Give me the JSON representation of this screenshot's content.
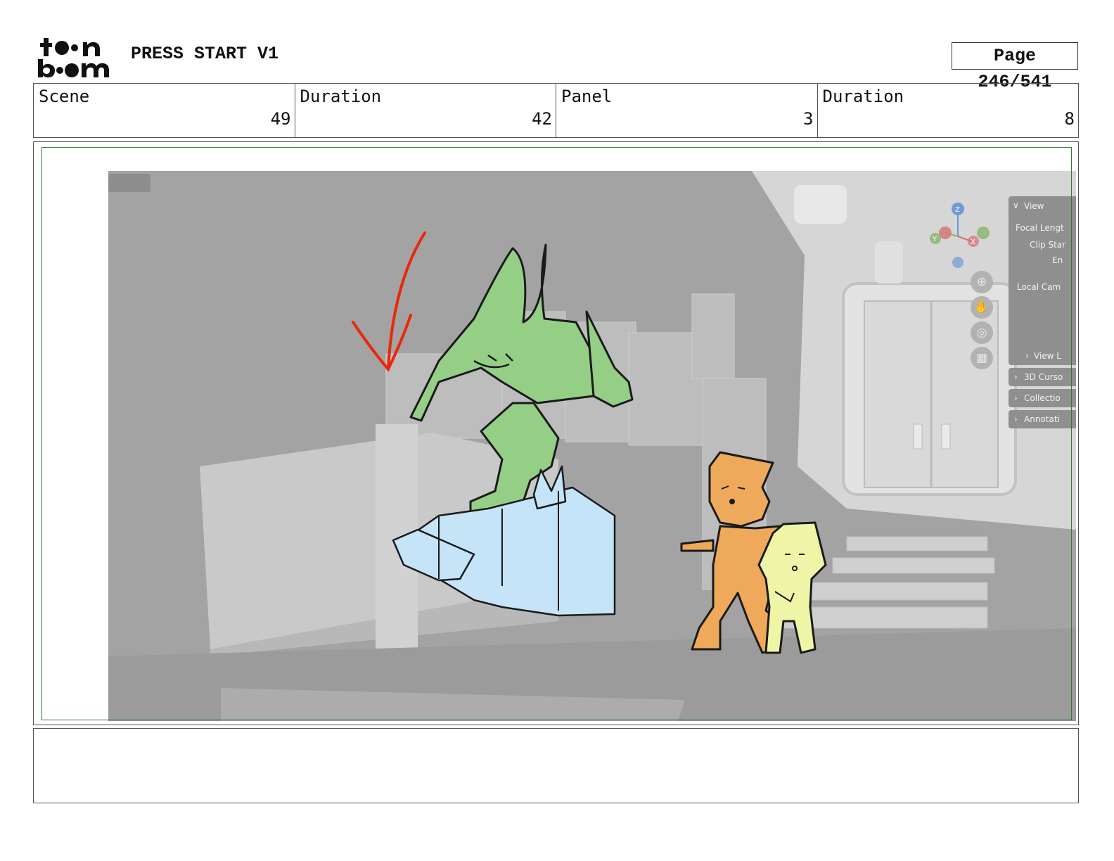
{
  "header": {
    "logo_text": "toon boom",
    "project_title": "PRESS START V1",
    "page_indicator": "Page 246/541"
  },
  "info": {
    "scene_label": "Scene",
    "scene_value": "49",
    "scene_duration_label": "Duration",
    "scene_duration_value": "42",
    "panel_label": "Panel",
    "panel_value": "3",
    "panel_duration_label": "Duration",
    "panel_duration_value": "8"
  },
  "viewport": {
    "sidebar": {
      "view_header": "View",
      "focal_length": "Focal Lengt",
      "clip_start": "Clip Star",
      "clip_end": "En",
      "local_camera": "Local Cam",
      "view_lock": "View L",
      "sections": [
        "3D Curso",
        "Collectio",
        "Annotati"
      ]
    },
    "gizmo": {
      "z": "Z",
      "y": "Y",
      "x": "X"
    },
    "nav_icons": [
      "zoom-icon",
      "hand-pan-icon",
      "camera-icon",
      "grid-icon"
    ]
  },
  "colors": {
    "safe_frame": "#2e7d32",
    "arrow": "#e8280a",
    "creature_fill": "#95cf86",
    "block_fill": "#c5e4f7",
    "girl_fill": "#eea95a",
    "small_char_fill": "#eff5a6",
    "viewport_bg": "#a3a3a3"
  },
  "notes": {
    "text": ""
  }
}
